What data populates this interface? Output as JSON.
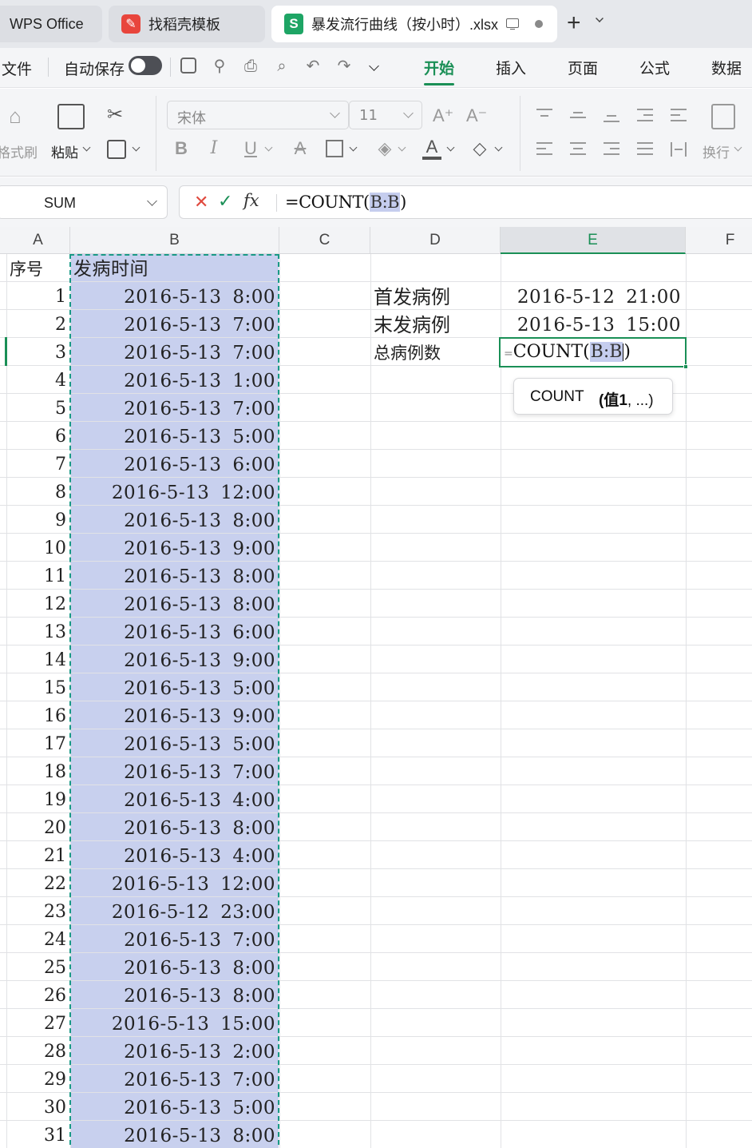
{
  "tabs": {
    "wps": "WPS Office",
    "templates": "找稻壳模板",
    "document": "暴发流行曲线（按小时）.xlsx",
    "new_tab": "+"
  },
  "menu": {
    "file": "文件",
    "autosave": "自动保存",
    "tabs": [
      "开始",
      "插入",
      "页面",
      "公式",
      "数据"
    ],
    "active_tab": "开始"
  },
  "ribbon": {
    "format_painter": "格式刷",
    "paste": "粘贴",
    "font_name": "宋体",
    "font_size": "11",
    "bold": "B",
    "italic": "I",
    "underline": "U",
    "wrap": "换行"
  },
  "formula_bar": {
    "name_box": "SUM",
    "formula_prefix": "=COUNT(",
    "formula_ref": "B:B",
    "formula_suffix": ")"
  },
  "columns": [
    "A",
    "B",
    "C",
    "D",
    "E",
    "F"
  ],
  "selected_column": "E",
  "header_row": {
    "a": "序号",
    "b": "发病时间"
  },
  "rows": [
    {
      "n": "1",
      "t": "2016-5-13 8:00"
    },
    {
      "n": "2",
      "t": "2016-5-13 7:00"
    },
    {
      "n": "3",
      "t": "2016-5-13 7:00"
    },
    {
      "n": "4",
      "t": "2016-5-13 1:00"
    },
    {
      "n": "5",
      "t": "2016-5-13 7:00"
    },
    {
      "n": "6",
      "t": "2016-5-13 5:00"
    },
    {
      "n": "7",
      "t": "2016-5-13 6:00"
    },
    {
      "n": "8",
      "t": "2016-5-13 12:00"
    },
    {
      "n": "9",
      "t": "2016-5-13 8:00"
    },
    {
      "n": "10",
      "t": "2016-5-13 9:00"
    },
    {
      "n": "11",
      "t": "2016-5-13 8:00"
    },
    {
      "n": "12",
      "t": "2016-5-13 8:00"
    },
    {
      "n": "13",
      "t": "2016-5-13 6:00"
    },
    {
      "n": "14",
      "t": "2016-5-13 9:00"
    },
    {
      "n": "15",
      "t": "2016-5-13 5:00"
    },
    {
      "n": "16",
      "t": "2016-5-13 9:00"
    },
    {
      "n": "17",
      "t": "2016-5-13 5:00"
    },
    {
      "n": "18",
      "t": "2016-5-13 7:00"
    },
    {
      "n": "19",
      "t": "2016-5-13 4:00"
    },
    {
      "n": "20",
      "t": "2016-5-13 8:00"
    },
    {
      "n": "21",
      "t": "2016-5-13 4:00"
    },
    {
      "n": "22",
      "t": "2016-5-13 12:00"
    },
    {
      "n": "23",
      "t": "2016-5-12 23:00"
    },
    {
      "n": "24",
      "t": "2016-5-13 7:00"
    },
    {
      "n": "25",
      "t": "2016-5-13 8:00"
    },
    {
      "n": "26",
      "t": "2016-5-13 8:00"
    },
    {
      "n": "27",
      "t": "2016-5-13 15:00"
    },
    {
      "n": "28",
      "t": "2016-5-13 2:00"
    },
    {
      "n": "29",
      "t": "2016-5-13 7:00"
    },
    {
      "n": "30",
      "t": "2016-5-13 5:00"
    },
    {
      "n": "31",
      "t": "2016-5-13 8:00"
    }
  ],
  "summary": {
    "first_label": "首发病例",
    "first_value": "2016-5-12 21:00",
    "last_label": "末发病例",
    "last_value": "2016-5-13 15:00",
    "total_label": "总病例数",
    "edit_prefix": "=",
    "edit_fn": "COUNT(",
    "edit_ref": "B:B",
    "edit_suffix": ")"
  },
  "tooltip": {
    "fn": "COUNT",
    "args_bold": "(值1",
    "args_rest": ", ...)"
  },
  "colors": {
    "accent": "#1a8f56",
    "selection": "#c8d0ee",
    "marching": "#1a9a86"
  }
}
